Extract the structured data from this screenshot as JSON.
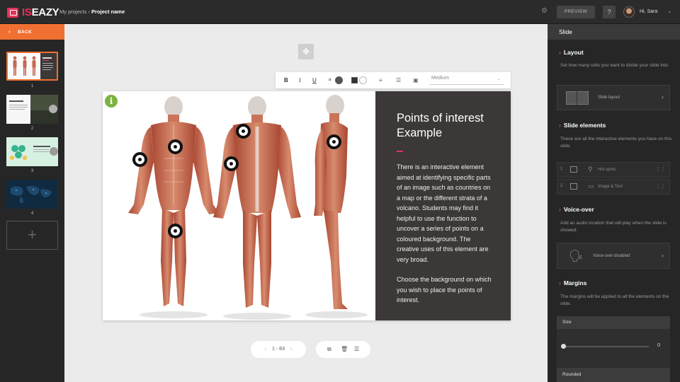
{
  "app": {
    "logo_prefix": "IS",
    "logo_suffix": "EAZY",
    "breadcrumb_parent": "My projects",
    "breadcrumb_sep": "›",
    "breadcrumb_current": "Project name"
  },
  "header": {
    "preview_label": "PREVIEW",
    "help_label": "?",
    "greeting": "Hi, Sara"
  },
  "sidebar": {
    "back_label": "BACK",
    "slides": [
      {
        "number": "1"
      },
      {
        "number": "2"
      },
      {
        "number": "3"
      },
      {
        "number": "4"
      }
    ],
    "add_label": "+"
  },
  "toolbar": {
    "bold": "B",
    "italic": "I",
    "underline": "U",
    "font_color": "a",
    "size_value": "Medium"
  },
  "slide": {
    "title": "Points of interest Example",
    "body": "There is an interactive element aimed at identifying specific parts of an image such as countries on a map or the different strata of a volcano. Students may find it helpful to use the function to uncover a series of points on a coloured background. The creative uses of this element are very broad.",
    "body2": "Choose the background on which you wish to place the points of interest.",
    "info_label": "i",
    "hotspot_count": 6
  },
  "pager": {
    "prev": "‹",
    "current": "1",
    "sep": "-",
    "total": "83",
    "next": "›"
  },
  "right_panel": {
    "header": "Slide",
    "layout": {
      "title": "Layout",
      "desc": "Set how many cells you want to divide your slide into.",
      "card_label": "Slide layout"
    },
    "elements": {
      "title": "Slide elements",
      "desc": "These are all the interactive elements you have on this slide.",
      "items": [
        {
          "num": "1",
          "label": "Hot spots"
        },
        {
          "num": "2",
          "label": "Image & Text"
        }
      ]
    },
    "voiceover": {
      "title": "Voice-over",
      "desc": "Add an audio location that will play when the slide is showed.",
      "card_label": "Voice-over disabled"
    },
    "margins": {
      "title": "Margins",
      "desc": "The margins will be applied to all the elements on the slide.",
      "size_label": "Size",
      "size_value": "0",
      "rounded_label": "Rounded"
    }
  },
  "colors": {
    "accent": "#f07032",
    "brand": "#e4335a",
    "info": "#7cb342",
    "panel_bg": "#3d3838"
  }
}
